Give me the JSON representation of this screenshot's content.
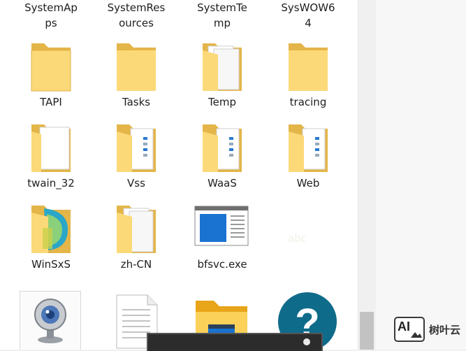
{
  "explorer": {
    "rows": [
      [
        {
          "label": "SystemAp\nps",
          "icon": "folder-icon"
        },
        {
          "label": "SystemRes\nources",
          "icon": "folder-icon"
        },
        {
          "label": "SystemTe\nmp",
          "icon": "folder-icon"
        },
        {
          "label": "SysWOW6\n4",
          "icon": "folder-icon"
        }
      ],
      [
        {
          "label": "TAPI",
          "icon": "folder-icon"
        },
        {
          "label": "Tasks",
          "icon": "folder-icon"
        },
        {
          "label": "Temp",
          "icon": "folder-documents-icon"
        },
        {
          "label": "tracing",
          "icon": "folder-icon"
        }
      ],
      [
        {
          "label": "twain_32",
          "icon": "folder-document-icon"
        },
        {
          "label": "Vss",
          "icon": "folder-files-icon"
        },
        {
          "label": "WaaS",
          "icon": "folder-files-icon"
        },
        {
          "label": "Web",
          "icon": "folder-files-icon"
        }
      ],
      [
        {
          "label": "WinSxS",
          "icon": "folder-winsxs-icon"
        },
        {
          "label": "zh-CN",
          "icon": "folder-documents-icon"
        },
        {
          "label": "bfsvc.exe",
          "icon": "exe-window-icon"
        }
      ],
      [
        {
          "label": "",
          "icon": "webcam-icon"
        },
        {
          "label": "",
          "icon": "text-file-icon"
        },
        {
          "label": "",
          "icon": "file-explorer-icon"
        },
        {
          "label": "",
          "icon": "help-icon"
        }
      ]
    ],
    "ghost_text": "abc"
  },
  "watermark": {
    "logo_text": "AI",
    "brand_text": "树叶云"
  },
  "colors": {
    "folder_back": "#e6b84a",
    "folder_front": "#fcd978",
    "help_blue": "#0f6b8a",
    "exe_blue": "#1a73d1"
  }
}
